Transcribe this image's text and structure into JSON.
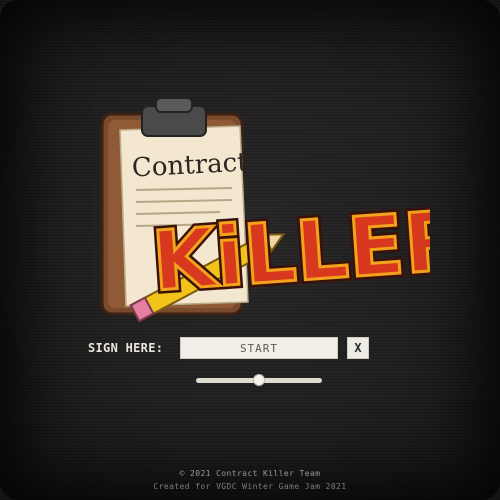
{
  "logo": {
    "contract_word": "Contract",
    "killer_word": "KiLLER"
  },
  "signature": {
    "label": "SIGN HERE:",
    "input_value": "START",
    "close_label": "X"
  },
  "slider": {
    "value_fraction": 0.5
  },
  "footer": {
    "copyright": "© 2021 Contract Killer Team",
    "credit": "Created for VGDC Winter Game Jam 2021"
  },
  "colors": {
    "background": "#1d1c1c",
    "killer_red": "#d8391e",
    "killer_orange": "#f2a21b",
    "clipboard_brown": "#7a4a2c",
    "paper": "#f3e8cf"
  }
}
